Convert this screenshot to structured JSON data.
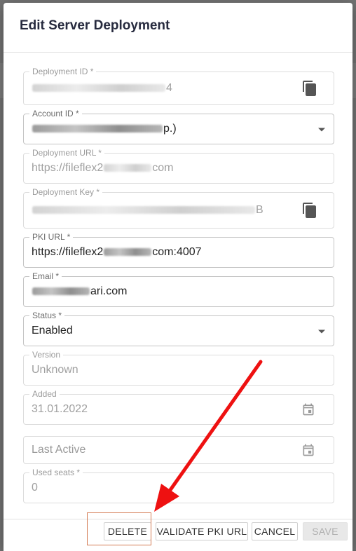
{
  "dialog": {
    "title": "Edit Server Deployment"
  },
  "fields": {
    "deployment_id": {
      "label": "Deployment ID *",
      "value_tail": "4"
    },
    "account_id": {
      "label": "Account ID *",
      "value_tail": "p.)"
    },
    "deployment_url": {
      "label": "Deployment URL *",
      "value_head": "https://fileflex2",
      "value_tail": "com"
    },
    "deployment_key": {
      "label": "Deployment Key *",
      "value_tail": "B"
    },
    "pki_url": {
      "label": "PKI URL *",
      "value_head": "https://fileflex2",
      "value_tail": "com:4007"
    },
    "email": {
      "label": "Email *",
      "value_tail": "ari.com"
    },
    "status": {
      "label": "Status *",
      "value": "Enabled"
    },
    "version": {
      "label": "Version",
      "value": "Unknown"
    },
    "added": {
      "label": "Added",
      "value": "31.01.2022"
    },
    "last_active": {
      "placeholder": "Last Active"
    },
    "used_seats": {
      "label": "Used seats *",
      "value": "0"
    }
  },
  "actions": {
    "delete": "DELETE",
    "validate_pki_url": "VALIDATE PKI URL",
    "cancel": "CANCEL",
    "save": "SAVE"
  },
  "colors": {
    "annotation_arrow": "#ee1111",
    "annotation_box": "#d47a52"
  },
  "icons": {
    "copy": "copy-icon",
    "calendar": "calendar-icon",
    "dropdown": "chevron-down-icon"
  }
}
